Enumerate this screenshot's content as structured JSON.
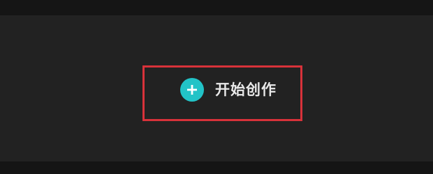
{
  "action": {
    "label": "开始创作",
    "icon": "plus-circle-icon",
    "icon_color": "#22c3c7"
  },
  "highlight": {
    "color": "#d8323a"
  }
}
